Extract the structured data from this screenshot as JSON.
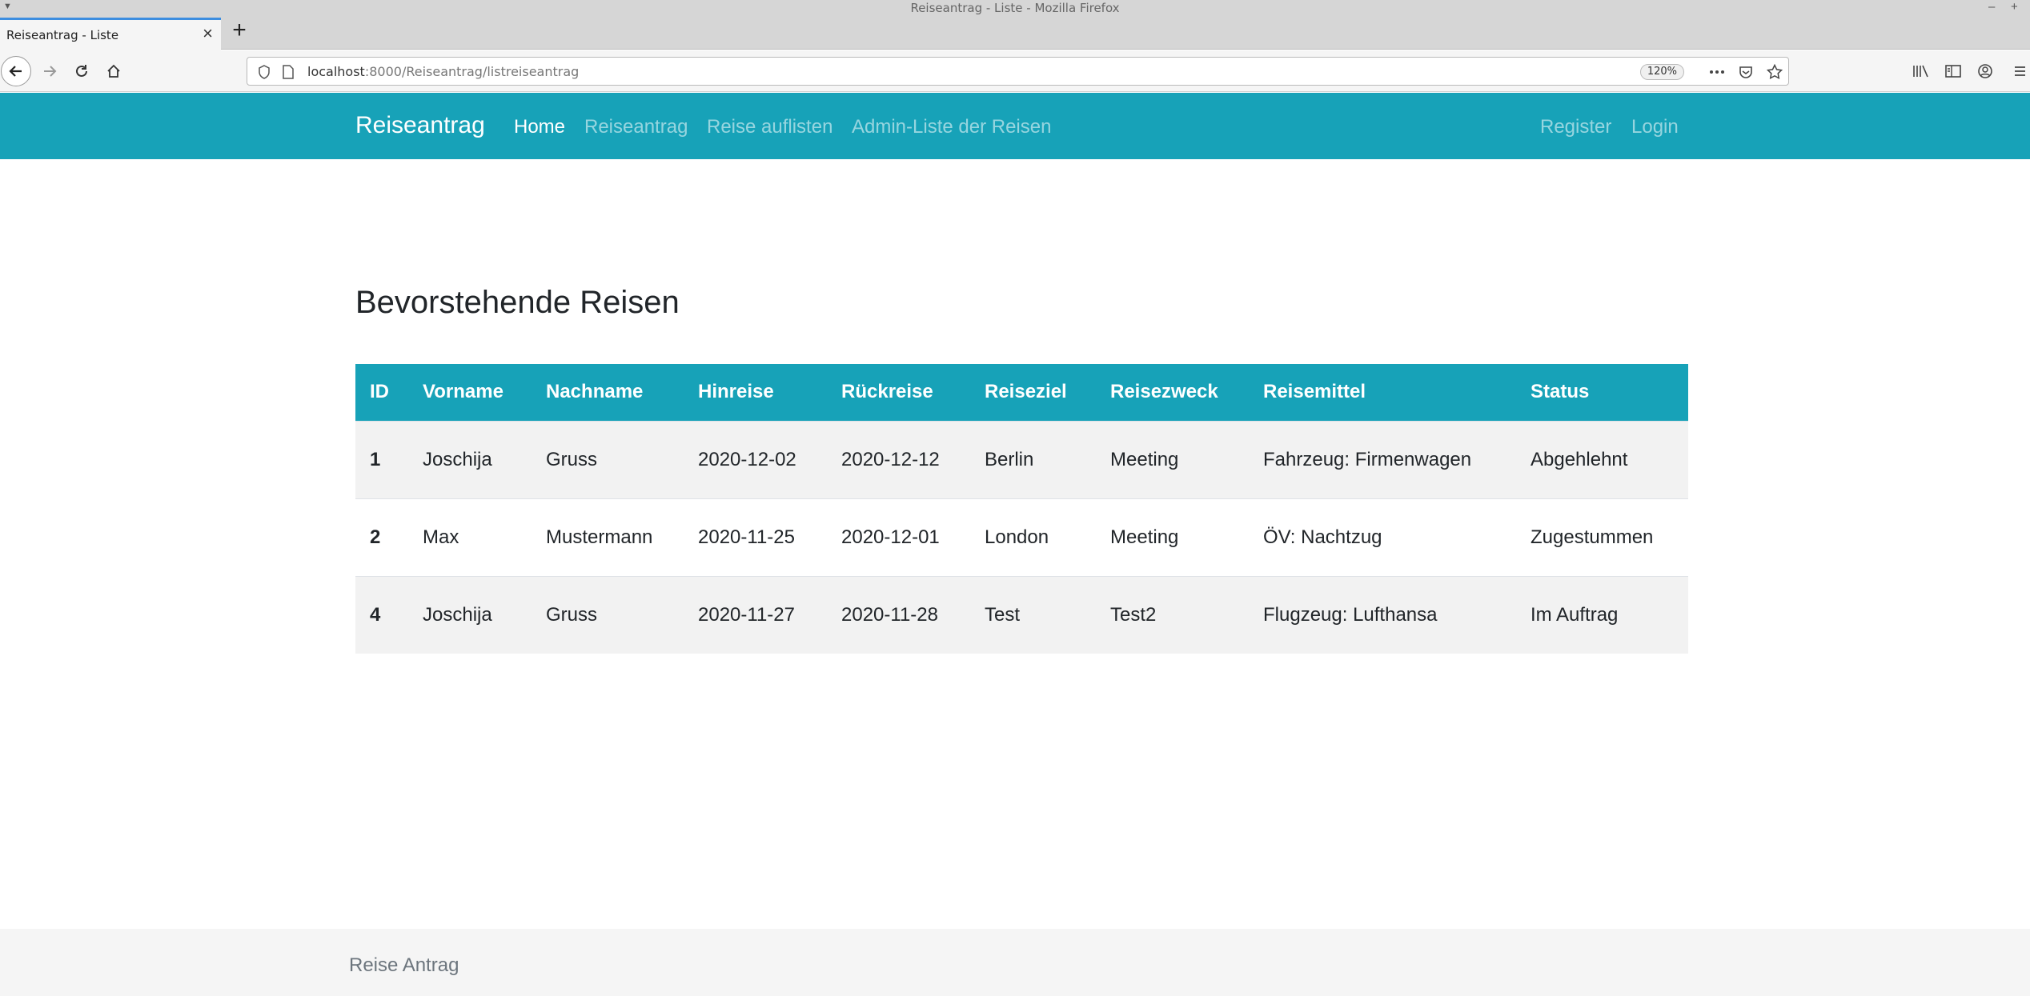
{
  "window": {
    "title": "Reiseantrag - Liste - Mozilla Firefox"
  },
  "browser": {
    "tab_title": "Reiseantrag - Liste",
    "url_host": "localhost",
    "url_rest": ":8000/Reiseantrag/listreiseantrag",
    "zoom": "120%"
  },
  "nav": {
    "brand": "Reiseantrag",
    "links": [
      {
        "label": "Home",
        "active": true
      },
      {
        "label": "Reiseantrag",
        "active": false
      },
      {
        "label": "Reise auflisten",
        "active": false
      },
      {
        "label": "Admin-Liste der Reisen",
        "active": false
      }
    ],
    "right": [
      {
        "label": "Register"
      },
      {
        "label": "Login"
      }
    ],
    "color": "#17a2b8"
  },
  "main": {
    "heading": "Bevorstehende Reisen",
    "table": {
      "headers": [
        "ID",
        "Vorname",
        "Nachname",
        "Hinreise",
        "Rückreise",
        "Reiseziel",
        "Reisezweck",
        "Reisemittel",
        "Status"
      ],
      "rows": [
        [
          "1",
          "Joschija",
          "Gruss",
          "2020-12-02",
          "2020-12-12",
          "Berlin",
          "Meeting",
          "Fahrzeug: Firmenwagen",
          "Abgehlehnt"
        ],
        [
          "2",
          "Max",
          "Mustermann",
          "2020-11-25",
          "2020-12-01",
          "London",
          "Meeting",
          "ÖV: Nachtzug",
          "Zugestummen"
        ],
        [
          "4",
          "Joschija",
          "Gruss",
          "2020-11-27",
          "2020-11-28",
          "Test",
          "Test2",
          "Flugzeug: Lufthansa",
          "Im Auftrag"
        ]
      ]
    }
  },
  "footer": {
    "text": "Reise Antrag"
  }
}
